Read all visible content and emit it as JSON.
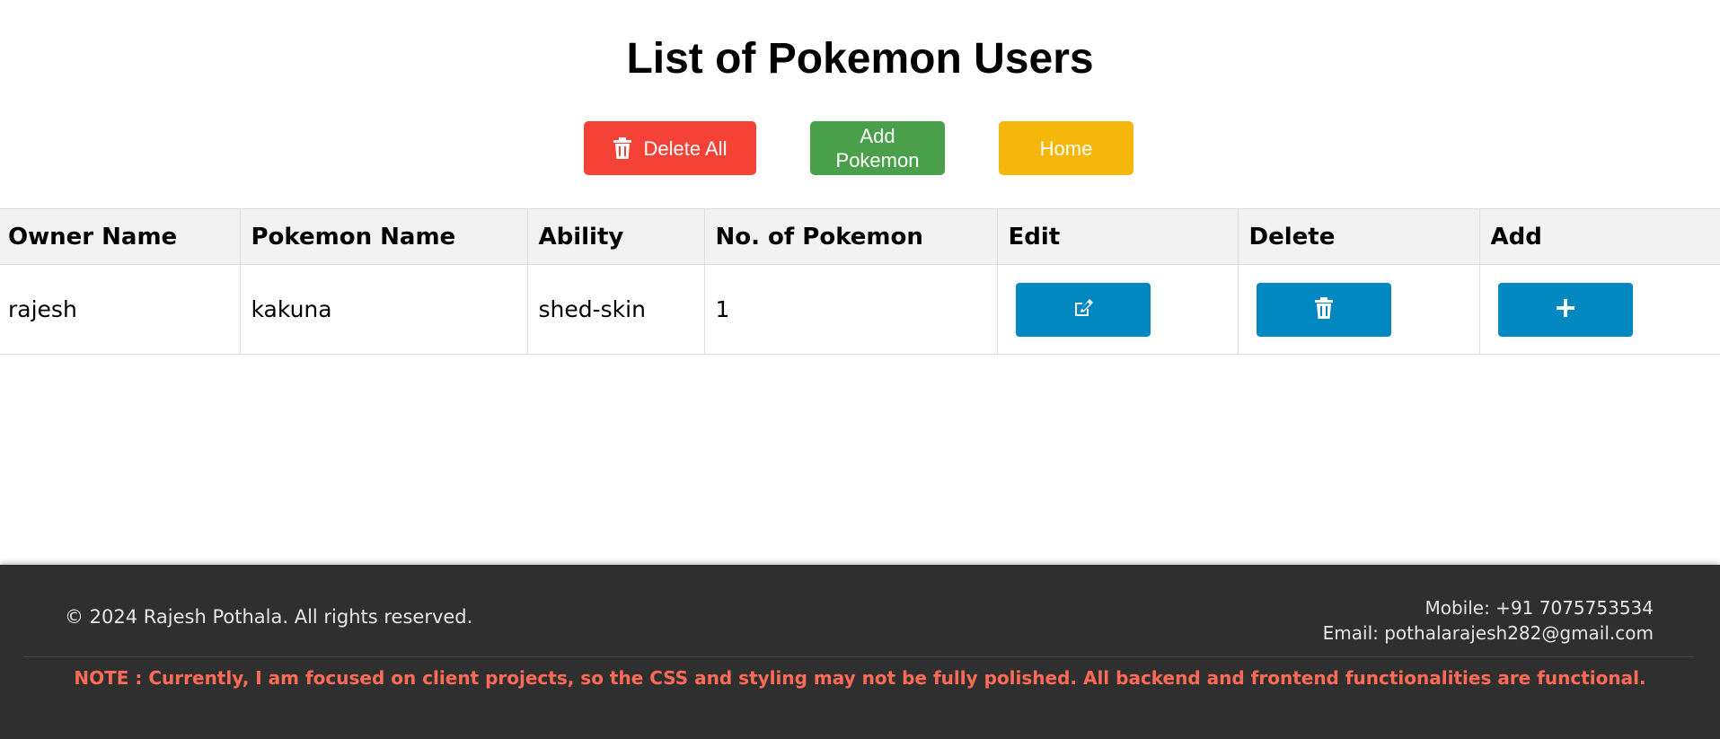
{
  "page": {
    "title": "List of Pokemon Users"
  },
  "toolbar": {
    "delete_all_label": "Delete All",
    "delete_all_icon": "trash-icon",
    "add_pokemon_label": "Add\nPokemon",
    "home_label": "Home"
  },
  "table": {
    "headers": [
      "Owner Name",
      "Pokemon Name",
      "Ability",
      "No. of Pokemon",
      "Edit",
      "Delete",
      "Add"
    ],
    "rows": [
      {
        "owner_name": "rajesh",
        "pokemon_name": "kakuna",
        "ability": "shed-skin",
        "count": "1",
        "edit_icon": "edit-icon",
        "delete_icon": "trash-icon",
        "add_icon": "plus-icon"
      }
    ]
  },
  "footer": {
    "copyright": "© 2024 Rajesh Pothala. All rights reserved.",
    "mobile": "Mobile: +91 7075753534",
    "email": "Email: pothalarajesh282@gmail.com",
    "note": "NOTE : Currently, I am focused on client projects, so the CSS and styling may not be fully polished. All backend and frontend functionalities are functional."
  },
  "colors": {
    "delete_all": "#f44336",
    "add_pokemon": "#4aa04a",
    "home": "#f5b70b",
    "action_button": "#0288c1",
    "footer_bg": "#2f2f2f",
    "note_text": "#ff6b57"
  }
}
